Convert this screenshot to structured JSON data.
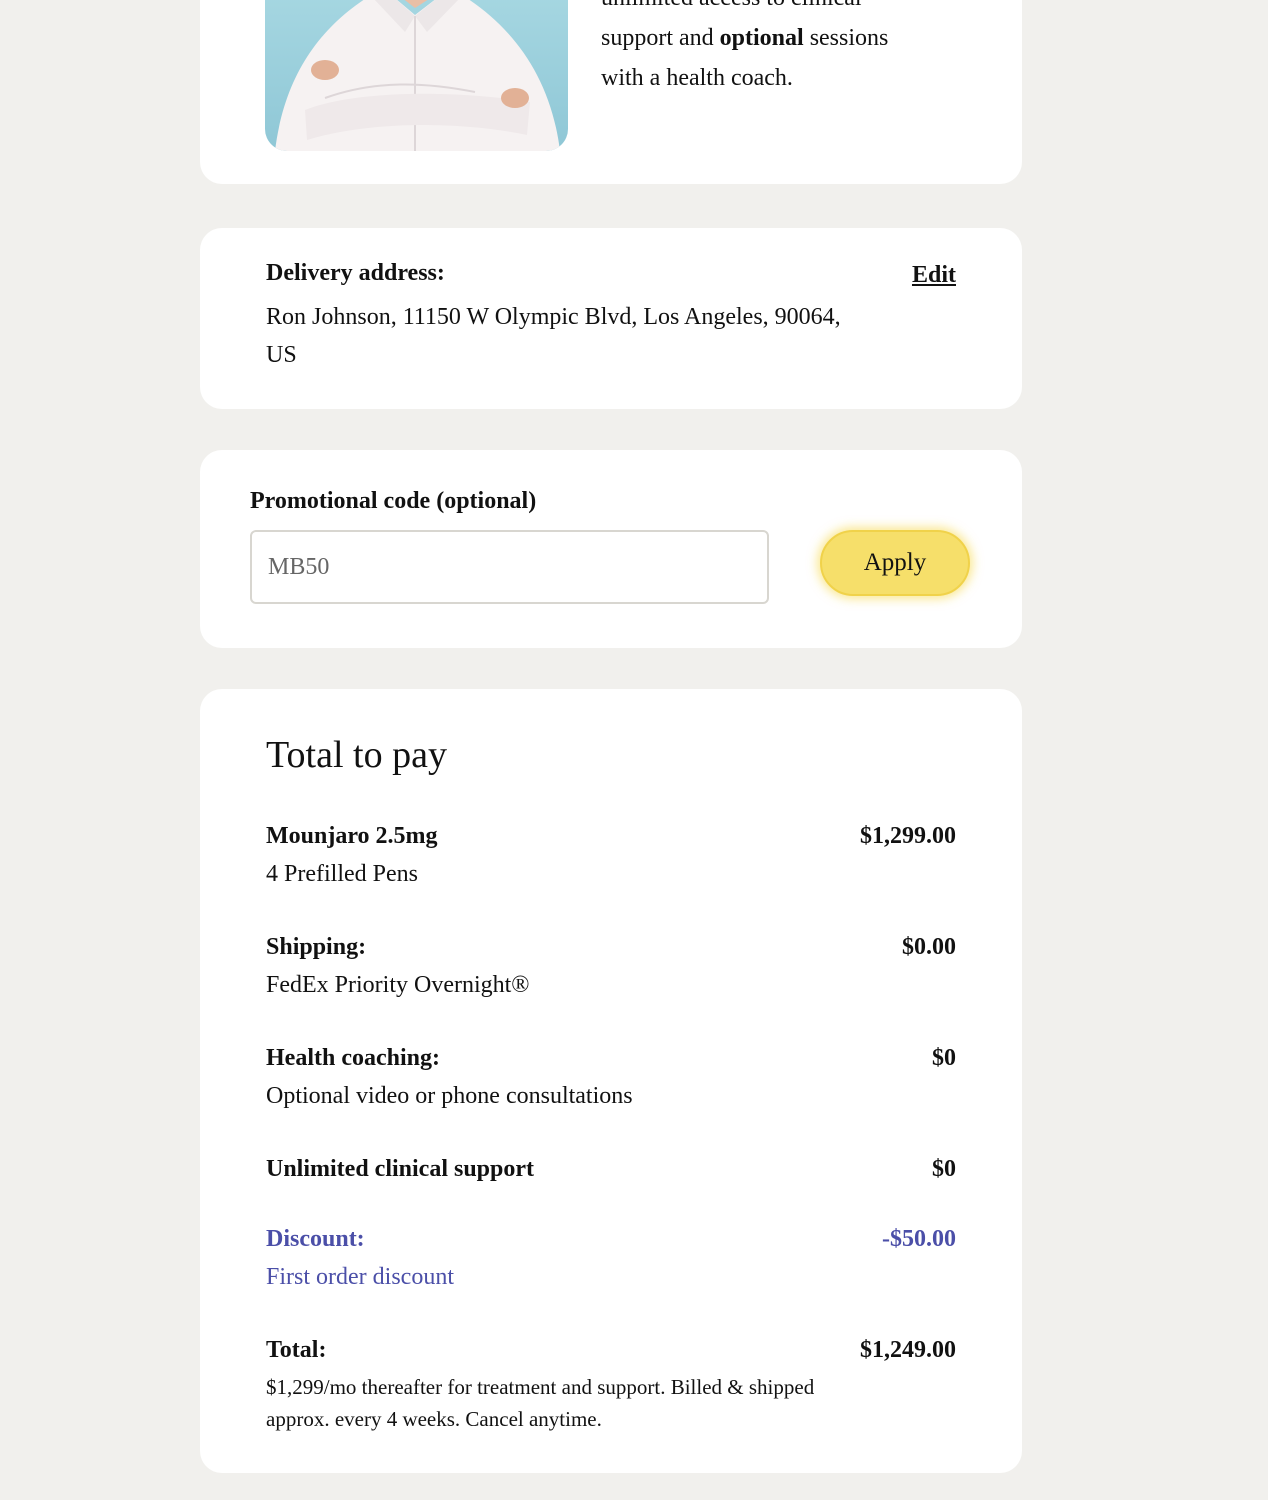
{
  "coach": {
    "photo_alt": "Health coach",
    "text_line1": "unlimited access to clinical",
    "text_line2_a": "support and ",
    "text_line2_b": "optional",
    "text_line2_c": " sessions",
    "text_line3": "with a health coach."
  },
  "delivery": {
    "label": "Delivery address:",
    "edit_label": "Edit",
    "address": "Ron Johnson, 11150 W Olympic Blvd, Los Angeles, 90064, US"
  },
  "promo": {
    "label": "Promotional code (optional)",
    "placeholder": "MB50",
    "apply_label": "Apply"
  },
  "total": {
    "title": "Total to pay",
    "items": [
      {
        "name": "Mounjaro 2.5mg",
        "sub": "4 Prefilled Pens",
        "price": "$1,299.00"
      },
      {
        "name": "Shipping:",
        "sub": "FedEx Priority Overnight®",
        "price": "$0.00"
      },
      {
        "name": "Health coaching:",
        "sub": "Optional video or phone consultations",
        "price": "$0"
      },
      {
        "name": "Unlimited clinical support",
        "sub": "",
        "price": "$0"
      }
    ],
    "discount": {
      "name": "Discount:",
      "sub": "First order discount",
      "price": "-$50.00",
      "color": "#4b4fa8"
    },
    "grand": {
      "name": "Total:",
      "price": "$1,249.00",
      "note": "$1,299/mo thereafter for treatment and support. Billed & shipped approx. every 4 weeks. Cancel anytime."
    }
  },
  "colors": {
    "background": "#f1f0ed",
    "card": "#ffffff",
    "apply_button": "#f6df6a",
    "discount_text": "#4b4fa8"
  }
}
